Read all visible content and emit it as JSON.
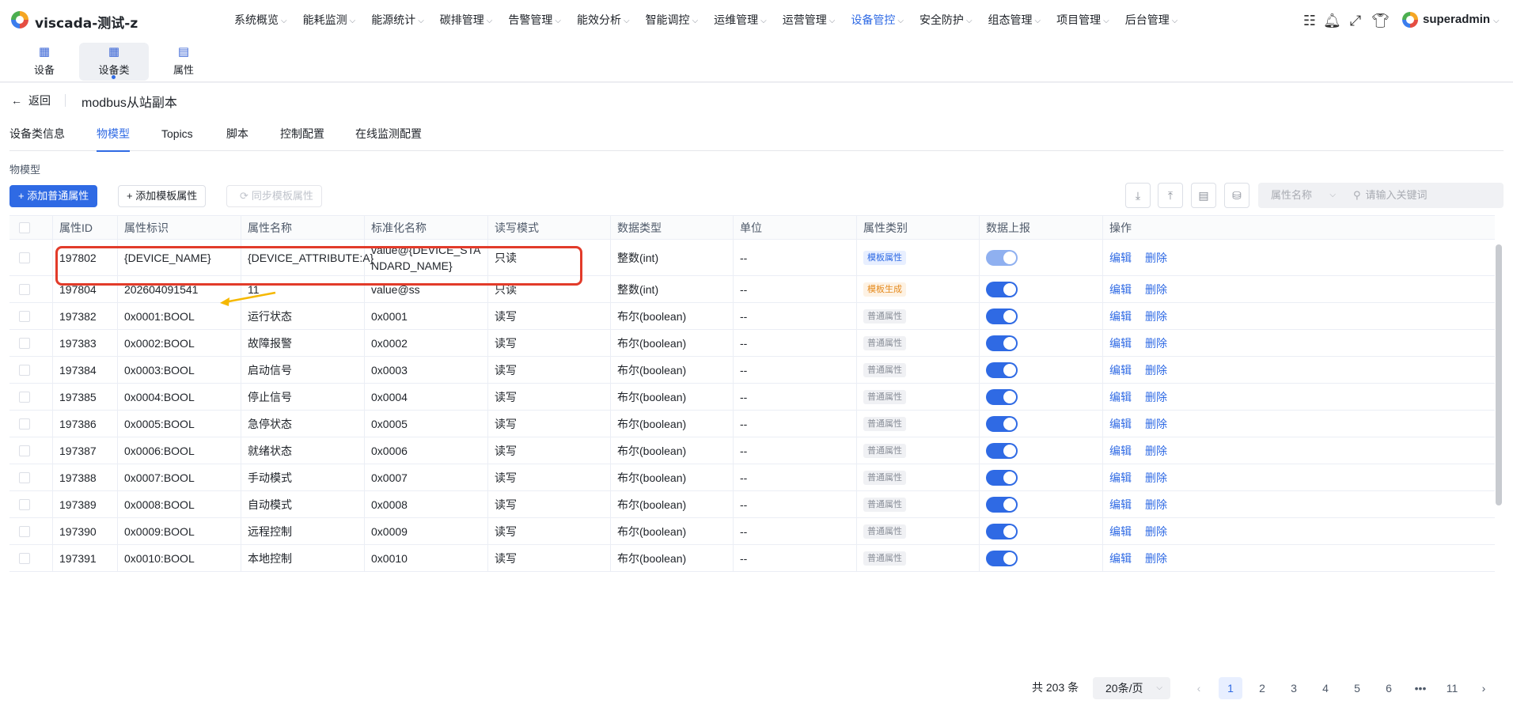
{
  "app": {
    "title": "viscada-测试-z",
    "user": "superadmin"
  },
  "nav": [
    {
      "label": "系统概览",
      "active": false
    },
    {
      "label": "能耗监测",
      "active": false
    },
    {
      "label": "能源统计",
      "active": false
    },
    {
      "label": "碳排管理",
      "active": false
    },
    {
      "label": "告警管理",
      "active": false
    },
    {
      "label": "能效分析",
      "active": false
    },
    {
      "label": "智能调控",
      "active": false
    },
    {
      "label": "运维管理",
      "active": false
    },
    {
      "label": "运营管理",
      "active": false
    },
    {
      "label": "设备管控",
      "active": true
    },
    {
      "label": "安全防护",
      "active": false
    },
    {
      "label": "组态管理",
      "active": false
    },
    {
      "label": "项目管理",
      "active": false
    },
    {
      "label": "后台管理",
      "active": false
    }
  ],
  "subnav": [
    {
      "label": "设备",
      "icon": "device-icon",
      "active": false
    },
    {
      "label": "设备类",
      "icon": "device-class-icon",
      "active": true
    },
    {
      "label": "属性",
      "icon": "property-icon",
      "active": false
    }
  ],
  "header": {
    "back_label": "返回",
    "title": "modbus从站副本"
  },
  "tabs": [
    {
      "label": "设备类信息",
      "active": false
    },
    {
      "label": "物模型",
      "active": true
    },
    {
      "label": "Topics",
      "active": false
    },
    {
      "label": "脚本",
      "active": false
    },
    {
      "label": "控制配置",
      "active": false
    },
    {
      "label": "在线监测配置",
      "active": false
    }
  ],
  "section_title": "物模型",
  "toolbar": {
    "add_normal": "+ 添加普通属性",
    "add_template": "+ 添加模板属性",
    "sync_template": "同步模板属性",
    "filter_select": "属性名称",
    "search_placeholder": "请输入关键词"
  },
  "table": {
    "columns": [
      "属性ID",
      "属性标识",
      "属性名称",
      "标准化名称",
      "读写模式",
      "数据类型",
      "单位",
      "属性类别",
      "数据上报",
      "操作"
    ],
    "actions": {
      "edit": "编辑",
      "delete": "删除"
    },
    "rows": [
      {
        "id": "197802",
        "key": "{DEVICE_NAME}",
        "name": "{DEVICE_ATTRIBUTE:A}",
        "std": "value@{DEVICE_STANDARD_NAME}",
        "mode": "只读",
        "type": "整数(int)",
        "unit": "--",
        "category": "模板属性",
        "cat_style": "template",
        "report": true
      },
      {
        "id": "197804",
        "key": "202604091541",
        "name": "11",
        "std": "value@ss",
        "mode": "只读",
        "type": "整数(int)",
        "unit": "--",
        "category": "模板生成",
        "cat_style": "gen",
        "report": true
      },
      {
        "id": "197382",
        "key": "0x0001:BOOL",
        "name": "运行状态",
        "std": "0x0001",
        "mode": "读写",
        "type": "布尔(boolean)",
        "unit": "--",
        "category": "普通属性",
        "cat_style": "normal",
        "report": true
      },
      {
        "id": "197383",
        "key": "0x0002:BOOL",
        "name": "故障报警",
        "std": "0x0002",
        "mode": "读写",
        "type": "布尔(boolean)",
        "unit": "--",
        "category": "普通属性",
        "cat_style": "normal",
        "report": true
      },
      {
        "id": "197384",
        "key": "0x0003:BOOL",
        "name": "启动信号",
        "std": "0x0003",
        "mode": "读写",
        "type": "布尔(boolean)",
        "unit": "--",
        "category": "普通属性",
        "cat_style": "normal",
        "report": true
      },
      {
        "id": "197385",
        "key": "0x0004:BOOL",
        "name": "停止信号",
        "std": "0x0004",
        "mode": "读写",
        "type": "布尔(boolean)",
        "unit": "--",
        "category": "普通属性",
        "cat_style": "normal",
        "report": true
      },
      {
        "id": "197386",
        "key": "0x0005:BOOL",
        "name": "急停状态",
        "std": "0x0005",
        "mode": "读写",
        "type": "布尔(boolean)",
        "unit": "--",
        "category": "普通属性",
        "cat_style": "normal",
        "report": true
      },
      {
        "id": "197387",
        "key": "0x0006:BOOL",
        "name": "就绪状态",
        "std": "0x0006",
        "mode": "读写",
        "type": "布尔(boolean)",
        "unit": "--",
        "category": "普通属性",
        "cat_style": "normal",
        "report": true
      },
      {
        "id": "197388",
        "key": "0x0007:BOOL",
        "name": "手动模式",
        "std": "0x0007",
        "mode": "读写",
        "type": "布尔(boolean)",
        "unit": "--",
        "category": "普通属性",
        "cat_style": "normal",
        "report": true
      },
      {
        "id": "197389",
        "key": "0x0008:BOOL",
        "name": "自动模式",
        "std": "0x0008",
        "mode": "读写",
        "type": "布尔(boolean)",
        "unit": "--",
        "category": "普通属性",
        "cat_style": "normal",
        "report": true
      },
      {
        "id": "197390",
        "key": "0x0009:BOOL",
        "name": "远程控制",
        "std": "0x0009",
        "mode": "读写",
        "type": "布尔(boolean)",
        "unit": "--",
        "category": "普通属性",
        "cat_style": "normal",
        "report": true
      },
      {
        "id": "197391",
        "key": "0x0010:BOOL",
        "name": "本地控制",
        "std": "0x0010",
        "mode": "读写",
        "type": "布尔(boolean)",
        "unit": "--",
        "category": "普通属性",
        "cat_style": "normal",
        "report": true
      }
    ]
  },
  "pagination": {
    "total": "共 203 条",
    "page_size": "20条/页",
    "pages": [
      "1",
      "2",
      "3",
      "4",
      "5",
      "6",
      "•••",
      "11"
    ],
    "current": "1"
  },
  "colors": {
    "primary": "#2f6ae4",
    "annotation_box": "#e23b2a",
    "annotation_arrow": "#f5b800"
  }
}
